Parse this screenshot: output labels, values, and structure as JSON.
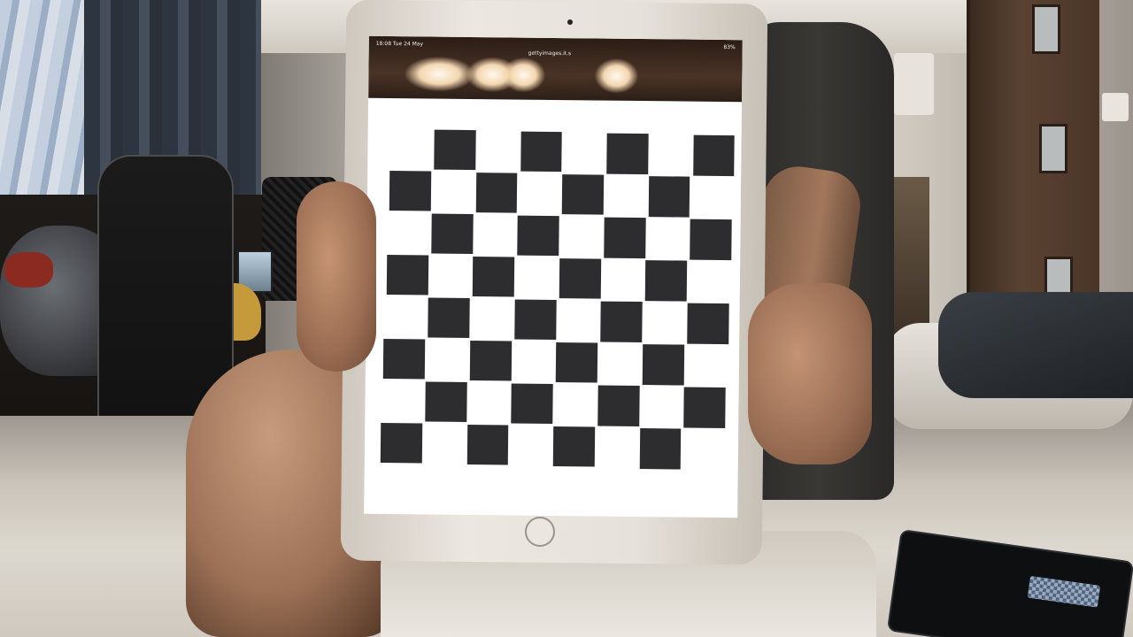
{
  "scene": {
    "description_kind": "photo of a person holding a tablet showing a checkerboard calibration pattern"
  },
  "tablet": {
    "status_time": "18:08  Tue 24 May",
    "status_battery": "83%",
    "address": "gettyimages.it.s",
    "tab_dots": "···"
  },
  "checkerboard": {
    "rows": 8,
    "cols": 8,
    "dark_color": "#2d2d2f",
    "light_color": "#ffffff"
  },
  "colors": {
    "tablet_frame": "#e6e1da",
    "screen": "#ffffff"
  }
}
